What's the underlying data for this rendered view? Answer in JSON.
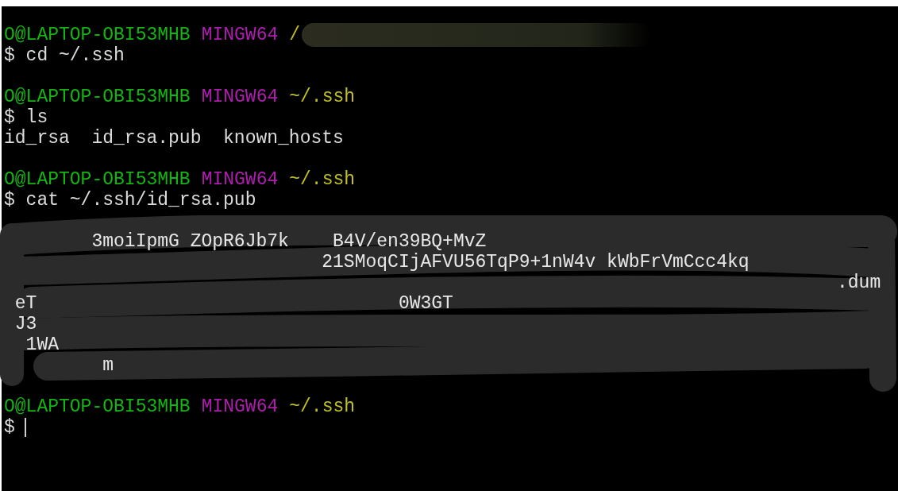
{
  "terminal": {
    "lines": [
      {
        "kind": "prompt",
        "user": "O@LAPTOP-OBI53MHB",
        "system": "MINGW64",
        "path": "/",
        "redacted": true
      },
      {
        "kind": "command",
        "text": "$ cd ~/.ssh"
      },
      {
        "kind": "blank"
      },
      {
        "kind": "prompt",
        "user": "O@LAPTOP-OBI53MHB",
        "system": "MINGW64",
        "path": "~/.ssh",
        "redacted": false
      },
      {
        "kind": "command",
        "text": "$ ls"
      },
      {
        "kind": "output",
        "text": "id_rsa  id_rsa.pub  known_hosts"
      },
      {
        "kind": "blank"
      },
      {
        "kind": "prompt",
        "user": "O@LAPTOP-OBI53MHB",
        "system": "MINGW64",
        "path": "~/.ssh",
        "redacted": false
      },
      {
        "kind": "command",
        "text": "$ cat ~/.ssh/id_rsa.pub"
      },
      {
        "kind": "redacted",
        "rows": [
          "        3moiIpmG ZOpR6Jb7k    B4V/en39BQ+MvZ",
          "                             21SMoqCIjAFVU56TqP9+1nW4v kWbFrVmCcc4kq",
          "                                                                            .dum",
          " eT                                 0W3GT",
          " J3",
          "  1WA",
          "         m"
        ]
      },
      {
        "kind": "blank"
      },
      {
        "kind": "prompt",
        "user": "O@LAPTOP-OBI53MHB",
        "system": "MINGW64",
        "path": "~/.ssh",
        "redacted": false
      },
      {
        "kind": "cursor",
        "text": "$"
      }
    ]
  }
}
